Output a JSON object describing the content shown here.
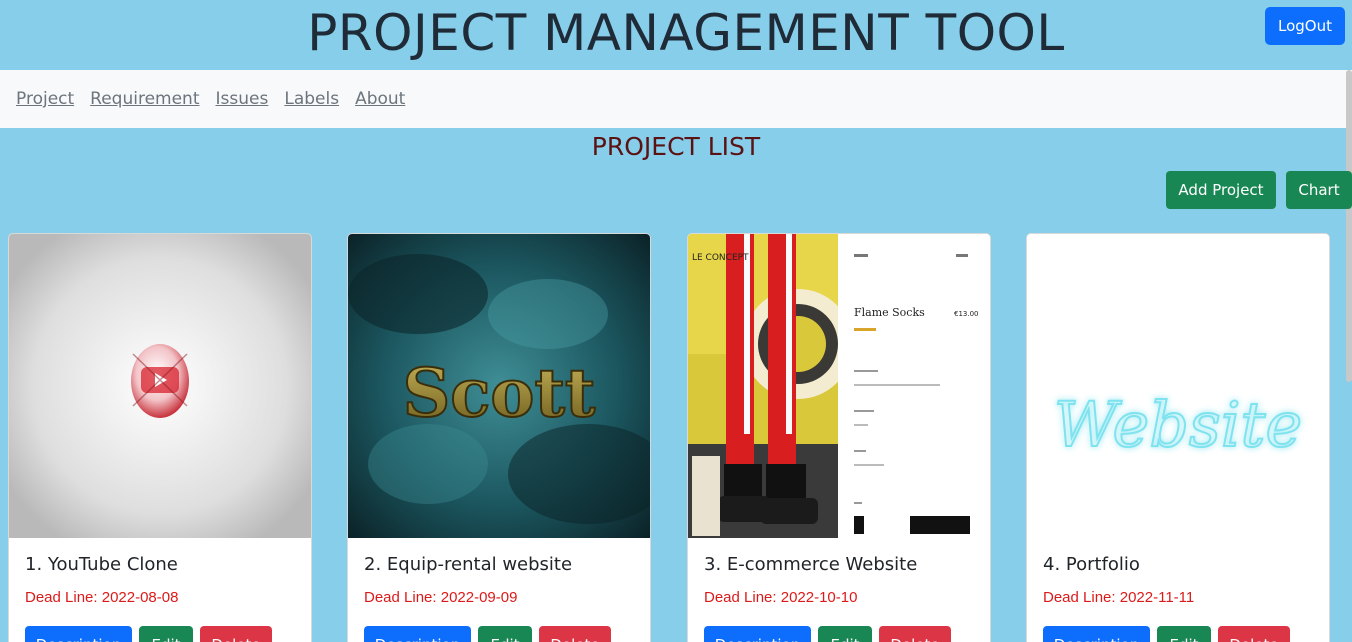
{
  "header": {
    "title": "PROJECT MANAGEMENT TOOL",
    "logout_label": "LogOut"
  },
  "nav": {
    "items": [
      {
        "label": "Project"
      },
      {
        "label": "Requirement"
      },
      {
        "label": "Issues"
      },
      {
        "label": "Labels"
      },
      {
        "label": "About"
      }
    ]
  },
  "main": {
    "heading": "PROJECT LIST",
    "add_project_label": "Add Project",
    "chart_label": "Chart"
  },
  "projects": [
    {
      "title": "1. YouTube Clone",
      "deadline": "Dead Line: 2022-08-08",
      "image_icon": "youtube-logo-image"
    },
    {
      "title": "2. Equip-rental website",
      "deadline": "Dead Line: 2022-09-09",
      "image_icon": "scott-logo-image",
      "image_text": "Scott"
    },
    {
      "title": "3. E-commerce Website",
      "deadline": "Dead Line: 2022-10-10",
      "image_icon": "socks-product-screenshot",
      "image_text": "Flame Socks",
      "image_brand": "LE CONCEPT",
      "image_price": "€13.00"
    },
    {
      "title": "4. Portfolio",
      "deadline": "Dead Line: 2022-11-11",
      "image_icon": "neon-website-image",
      "image_text": "Website"
    }
  ],
  "card_buttons": {
    "description_label": "Description",
    "edit_label": "Edit",
    "delete_label": "Delete"
  },
  "colors": {
    "background": "#87ceeb",
    "primary": "#0d6efd",
    "success": "#198754",
    "danger": "#dc3545",
    "deadline": "#dc1a1a",
    "heading": "#5a1212"
  }
}
